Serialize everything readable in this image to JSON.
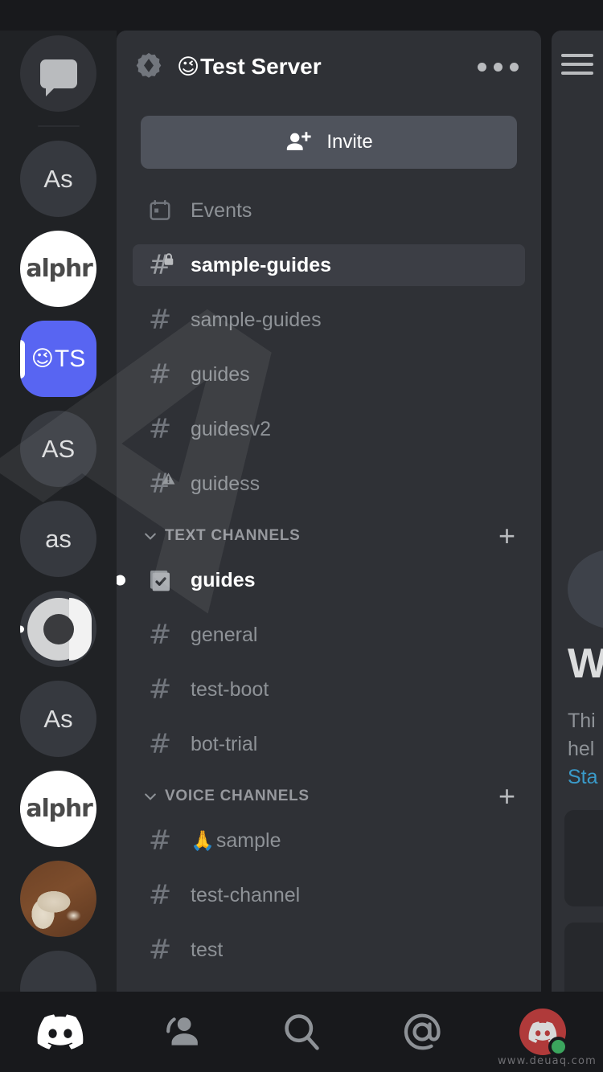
{
  "app": {
    "name": "Discord",
    "platform": "mobile"
  },
  "watermark": {
    "big_text": "A",
    "url": "www.deuaq.com"
  },
  "server_rail": {
    "items": [
      {
        "name": "direct-messages",
        "label": "",
        "icon": "chat-bubble-icon",
        "type": "dm",
        "selected": false
      },
      {
        "name": "server-as-1",
        "label": "As",
        "type": "initials",
        "selected": false
      },
      {
        "name": "server-alphr-1",
        "label": "alphr",
        "type": "logo-alphr",
        "selected": false
      },
      {
        "name": "server-test-server",
        "label": "TS",
        "emoji": "😉",
        "type": "initials",
        "selected": true
      },
      {
        "name": "server-as-2",
        "label": "AS",
        "type": "initials",
        "selected": false
      },
      {
        "name": "server-as-3",
        "label": "as",
        "type": "initials",
        "selected": false
      },
      {
        "name": "server-ring",
        "label": "",
        "type": "logo-ring",
        "selected": false,
        "unread": true
      },
      {
        "name": "server-as-4",
        "label": "As",
        "type": "initials",
        "selected": false
      },
      {
        "name": "server-alphr-2",
        "label": "alphr",
        "type": "logo-alphr",
        "selected": false,
        "unread": true
      },
      {
        "name": "server-dog",
        "label": "",
        "type": "photo-dog",
        "selected": false
      }
    ]
  },
  "header": {
    "badge_icon": "verified-server-badge-icon",
    "emoji": "😉",
    "title": "Test Server",
    "overflow_label": "more-options"
  },
  "invite": {
    "label": "Invite",
    "icon": "person-add-icon"
  },
  "channels": {
    "top_items": [
      {
        "label": "Events",
        "icon": "calendar-icon",
        "state": "normal"
      },
      {
        "label": "sample-guides",
        "icon": "hash-lock-icon",
        "state": "active"
      },
      {
        "label": "sample-guides",
        "icon": "hash-icon",
        "state": "normal"
      },
      {
        "label": "guides",
        "icon": "hash-icon",
        "state": "normal"
      },
      {
        "label": "guidesv2",
        "icon": "hash-icon",
        "state": "normal"
      },
      {
        "label": "guidess",
        "icon": "hash-warning-icon",
        "state": "normal"
      }
    ],
    "categories": [
      {
        "label": "TEXT CHANNELS",
        "add_label": "+",
        "items": [
          {
            "label": "guides",
            "icon": "rules-channel-icon",
            "state": "unread"
          },
          {
            "label": "general",
            "icon": "hash-icon",
            "state": "normal"
          },
          {
            "label": "test-boot",
            "icon": "hash-icon",
            "state": "normal"
          },
          {
            "label": "bot-trial",
            "icon": "hash-icon",
            "state": "normal"
          }
        ]
      },
      {
        "label": "VOICE CHANNELS",
        "add_label": "+",
        "items": [
          {
            "label": "sample",
            "emoji": "🙏",
            "icon": "hash-icon",
            "state": "normal"
          },
          {
            "label": "test-channel",
            "icon": "hash-icon",
            "state": "normal"
          },
          {
            "label": "test",
            "icon": "hash-icon",
            "state": "normal"
          }
        ]
      }
    ]
  },
  "peek_panel": {
    "menu_icon": "hamburger-menu-icon",
    "heading": "W",
    "line1": "Thi",
    "line2": "hel",
    "link": "Sta"
  },
  "bottom_nav": {
    "items": [
      {
        "name": "home",
        "icon": "discord-logo-icon",
        "active": true
      },
      {
        "name": "friends",
        "icon": "friends-icon",
        "active": false
      },
      {
        "name": "search",
        "icon": "search-icon",
        "active": false
      },
      {
        "name": "mentions",
        "icon": "at-mention-icon",
        "active": false
      },
      {
        "name": "profile",
        "icon": "user-avatar-icon",
        "active": false,
        "status": "online"
      }
    ]
  },
  "colors": {
    "rail_bg": "#202225",
    "panel_bg": "#2f3136",
    "app_bg": "#18191c",
    "selected_row": "#3c3e45",
    "blurple": "#5865F2",
    "invite_btn": "#4f535c",
    "online_green": "#3ba55d",
    "muted_text": "#8e9297",
    "link_blue": "#3a9ac9"
  }
}
